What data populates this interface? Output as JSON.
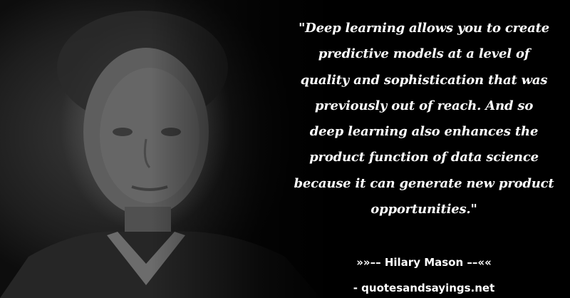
{
  "quote": {
    "lines": [
      "\"Deep learning allows you to create",
      "predictive models at a level of",
      "quality and sophistication that was",
      "previously out of reach. And so",
      "deep learning also enhances the",
      "product function of data science",
      "because it can generate new product",
      "opportunities.\""
    ]
  },
  "attribution": {
    "text": "»»–– Hilary Mason ––««"
  },
  "source": {
    "text": "- quotesandsayings.net"
  },
  "colors": {
    "background": "#000000",
    "text": "#ffffff"
  },
  "portrait": {
    "style": "grayscale"
  }
}
